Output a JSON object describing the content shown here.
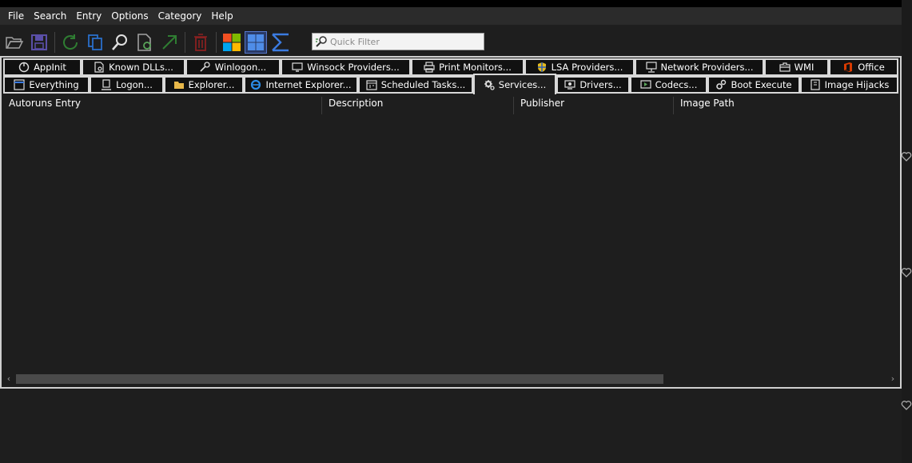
{
  "menu": [
    "File",
    "Search",
    "Entry",
    "Options",
    "Category",
    "Help"
  ],
  "toolbar": {
    "buttons": [
      {
        "name": "open-icon"
      },
      {
        "name": "save-icon"
      },
      {
        "name": "refresh-icon"
      },
      {
        "name": "copy-icon"
      },
      {
        "name": "find-icon"
      },
      {
        "name": "scan-options-icon"
      },
      {
        "name": "jump-to-icon"
      },
      {
        "name": "delete-icon"
      },
      {
        "name": "windows-entries-icon"
      },
      {
        "name": "microsoft-entries-icon"
      },
      {
        "name": "virustotal-icon"
      }
    ],
    "filter_placeholder": "Quick Filter"
  },
  "tabs_row1": [
    {
      "label": "AppInit",
      "icon": "appinit-icon"
    },
    {
      "label": "Known DLLs...",
      "icon": "known-dlls-icon"
    },
    {
      "label": "Winlogon...",
      "icon": "winlogon-icon"
    },
    {
      "label": "Winsock Providers...",
      "icon": "winsock-icon"
    },
    {
      "label": "Print Monitors...",
      "icon": "printer-icon"
    },
    {
      "label": "LSA Providers...",
      "icon": "shield-icon"
    },
    {
      "label": "Network Providers...",
      "icon": "network-icon"
    },
    {
      "label": "WMI",
      "icon": "wmi-icon"
    },
    {
      "label": "Office",
      "icon": "office-icon"
    }
  ],
  "tabs_row2": [
    {
      "label": "Everything",
      "icon": "everything-icon"
    },
    {
      "label": "Logon...",
      "icon": "logon-icon"
    },
    {
      "label": "Explorer...",
      "icon": "folder-icon"
    },
    {
      "label": "Internet Explorer...",
      "icon": "internet-explorer-icon"
    },
    {
      "label": "Scheduled Tasks...",
      "icon": "scheduled-tasks-icon"
    },
    {
      "label": "Services...",
      "icon": "gear-icon",
      "selected": true
    },
    {
      "label": "Drivers...",
      "icon": "drivers-icon"
    },
    {
      "label": "Codecs...",
      "icon": "codecs-icon"
    },
    {
      "label": "Boot Execute",
      "icon": "boot-execute-icon"
    },
    {
      "label": "Image Hijacks",
      "icon": "image-hijacks-icon"
    }
  ],
  "columns": [
    "Autoruns Entry",
    "Description",
    "Publisher",
    "Image Path"
  ],
  "rows": []
}
